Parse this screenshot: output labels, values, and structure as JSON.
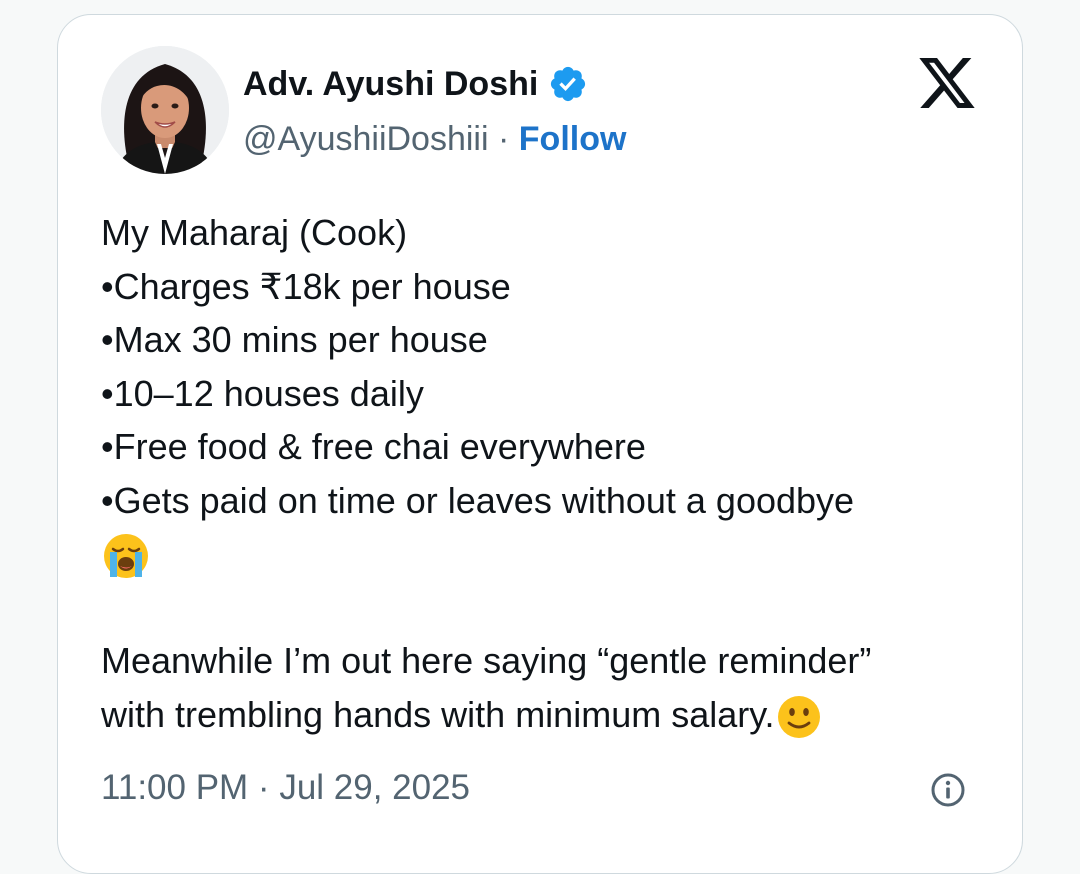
{
  "author": {
    "name": "Adv. Ayushi Doshi",
    "handle": "@AyushiiDoshiii",
    "separator": "·",
    "follow_label": "Follow",
    "verified": true
  },
  "icons": {
    "avatar": "profile-photo",
    "verified": "verified-badge-icon",
    "logo": "x-logo-icon",
    "info": "info-icon"
  },
  "colors": {
    "follow": "#1d73c9",
    "verified": "#1d9bf0",
    "text": "#0f1419",
    "muted": "#536471",
    "border": "#cfd9de"
  },
  "tweet": {
    "line1": "My Maharaj (Cook)",
    "line2": "•Charges ₹18k per house",
    "line3": "•Max 30 mins per house",
    "line4": "•10–12 houses daily",
    "line5": "•Free food & free chai everywhere",
    "line6": "•Gets paid on time or leaves without a goodbye",
    "line7_emoji": "loudly-crying-face",
    "line8": "Meanwhile I’m out here saying “gentle reminder”",
    "line9": "with trembling hands with minimum salary.",
    "line9_emoji": "slightly-smiling-face"
  },
  "meta": {
    "timestamp": "11:00 PM · Jul 29, 2025"
  }
}
